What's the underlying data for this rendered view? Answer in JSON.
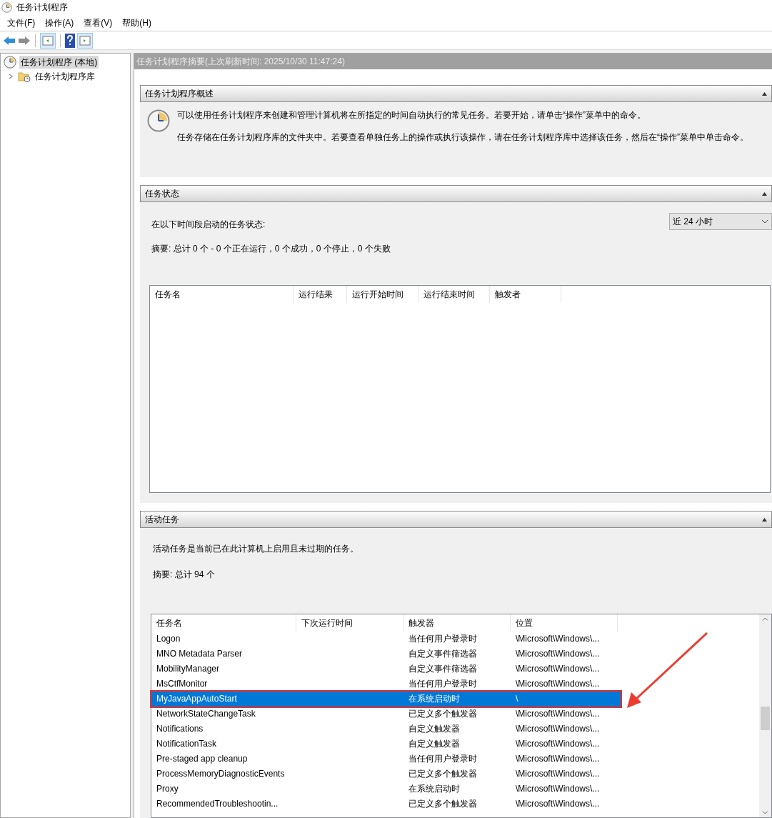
{
  "window": {
    "title": "任务计划程序"
  },
  "menu": [
    "文件(F)",
    "操作(A)",
    "查看(V)",
    "帮助(H)"
  ],
  "tree": [
    {
      "label": "任务计划程序 (本地)",
      "selected": true,
      "children": [
        {
          "label": "任务计划程序库",
          "selected": false,
          "expanded": false
        }
      ]
    }
  ],
  "summary_header": "任务计划程序摘要(上次刷新时间: 2025/10/30 11:47:24)",
  "overview": {
    "title": "任务计划程序概述",
    "expanded": true,
    "paragraphs": [
      "可以使用任务计划程序来创建和管理计算机将在所指定的时间自动执行的常见任务。若要开始，请单击“操作”菜单中的命令。",
      "任务存储在任务计划程序库的文件夹中。若要查看单独任务上的操作或执行该操作，请在任务计划程序库中选择该任务，然后在“操作”菜单中单击命令。"
    ]
  },
  "task_status": {
    "title": "任务状态",
    "expanded": true,
    "period_label": "在以下时间段启动的任务状态:",
    "period": "近 24 小时",
    "summary": "摘要: 总计 0 个 - 0 个正在运行，0 个成功，0 个停止，0 个失败",
    "columns": [
      "任务名",
      "运行结果",
      "运行开始时间",
      "运行结束时间",
      "触发者"
    ]
  },
  "active_tasks": {
    "title": "活动任务",
    "expanded": true,
    "description": "活动任务是当前已在此计算机上启用且未过期的任务。",
    "summary": "摘要: 总计 94 个",
    "columns": [
      "任务名",
      "下次运行时间",
      "触发器",
      "位置"
    ],
    "rows": [
      {
        "name": "Logon",
        "trigger": "当任何用户登录时",
        "location": "\\Microsoft\\Windows\\...",
        "selected": false,
        "highlighted": false
      },
      {
        "name": "MNO Metadata Parser",
        "trigger": "自定义事件筛选器",
        "location": "\\Microsoft\\Windows\\...",
        "selected": false,
        "highlighted": false
      },
      {
        "name": "MobilityManager",
        "trigger": "自定义事件筛选器",
        "location": "\\Microsoft\\Windows\\...",
        "selected": false,
        "highlighted": false
      },
      {
        "name": "MsCtfMonitor",
        "trigger": "当任何用户登录时",
        "location": "\\Microsoft\\Windows\\...",
        "selected": false,
        "highlighted": false
      },
      {
        "name": "MyJavaAppAutoStart",
        "trigger": "在系统启动时",
        "location": "\\",
        "selected": true,
        "highlighted": true
      },
      {
        "name": "NetworkStateChangeTask",
        "trigger": "已定义多个触发器",
        "location": "\\Microsoft\\Windows\\...",
        "selected": false,
        "highlighted": false
      },
      {
        "name": "Notifications",
        "trigger": "自定义触发器",
        "location": "\\Microsoft\\Windows\\...",
        "selected": false,
        "highlighted": false
      },
      {
        "name": "NotificationTask",
        "trigger": "自定义触发器",
        "location": "\\Microsoft\\Windows\\...",
        "selected": false,
        "highlighted": false
      },
      {
        "name": "Pre-staged app cleanup",
        "trigger": "当任何用户登录时",
        "location": "\\Microsoft\\Windows\\...",
        "selected": false,
        "highlighted": false
      },
      {
        "name": "ProcessMemoryDiagnosticEvents",
        "trigger": "已定义多个触发器",
        "location": "\\Microsoft\\Windows\\...",
        "selected": false,
        "highlighted": false
      },
      {
        "name": "Proxy",
        "trigger": "在系统启动时",
        "location": "\\Microsoft\\Windows\\...",
        "selected": false,
        "highlighted": false
      },
      {
        "name": "RecommendedTroubleshootin...",
        "trigger": "已定义多个触发器",
        "location": "\\Microsoft\\Windows\\...",
        "selected": false,
        "highlighted": false
      }
    ]
  }
}
